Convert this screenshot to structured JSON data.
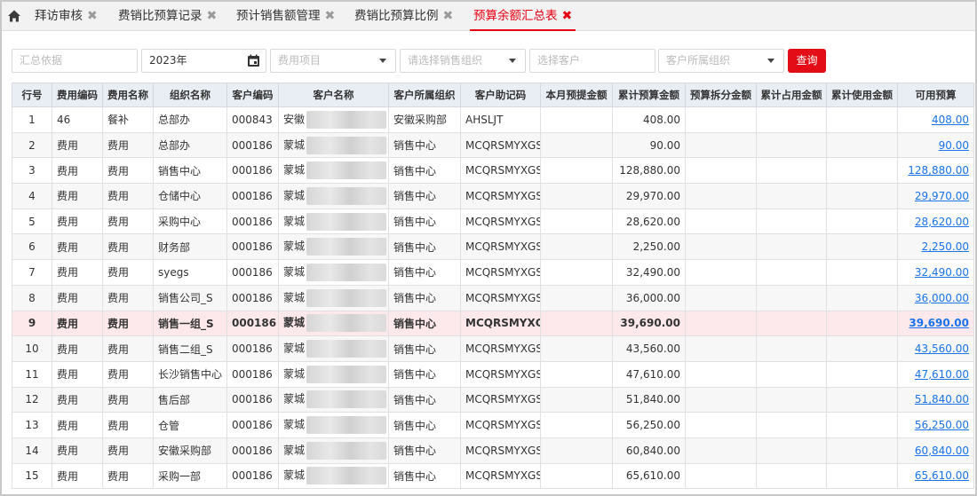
{
  "tabs": [
    {
      "label": "拜访审核",
      "close": "✖"
    },
    {
      "label": "费销比预算记录",
      "close": "✖"
    },
    {
      "label": "预计销售额管理",
      "close": "✖"
    },
    {
      "label": "费销比预算比例",
      "close": "✖"
    },
    {
      "label": "预算余额汇总表",
      "close": "✖"
    }
  ],
  "filters": {
    "summary_basis_placeholder": "汇总依据",
    "year_value": "2023年",
    "expense_item_placeholder": "费用项目",
    "sales_org_placeholder": "请选择销售组织",
    "customer_placeholder": "选择客户",
    "customer_org_placeholder": "客户所属组织",
    "query_label": "查询"
  },
  "columns": [
    "行号",
    "费用编码",
    "费用名称",
    "组织名称",
    "客户编码",
    "客户名称",
    "客户所属组织",
    "客户助记码",
    "本月预提金额",
    "累计预算金额",
    "预算拆分金额",
    "累计占用金额",
    "累计使用金额",
    "可用预算"
  ],
  "rows": [
    {
      "no": "1",
      "code": "46",
      "name": "餐补",
      "org": "总部办",
      "cust_code": "000843",
      "cust_name": "安徽",
      "cust_org": "安徽采购部",
      "mnemonic": "AHSLJT",
      "month": "",
      "budget": "408.00",
      "split": "",
      "occupied": "",
      "used": "",
      "available": "408.00"
    },
    {
      "no": "2",
      "code": "费用",
      "name": "费用",
      "org": "总部办",
      "cust_code": "000186",
      "cust_name": "蒙城",
      "cust_org": "销售中心",
      "mnemonic": "MCQRSMYXGS",
      "month": "",
      "budget": "90.00",
      "split": "",
      "occupied": "",
      "used": "",
      "available": "90.00"
    },
    {
      "no": "3",
      "code": "费用",
      "name": "费用",
      "org": "销售中心",
      "cust_code": "000186",
      "cust_name": "蒙城",
      "cust_org": "销售中心",
      "mnemonic": "MCQRSMYXGS",
      "month": "",
      "budget": "128,880.00",
      "split": "",
      "occupied": "",
      "used": "",
      "available": "128,880.00"
    },
    {
      "no": "4",
      "code": "费用",
      "name": "费用",
      "org": "仓储中心",
      "cust_code": "000186",
      "cust_name": "蒙城",
      "cust_org": "销售中心",
      "mnemonic": "MCQRSMYXGS",
      "month": "",
      "budget": "29,970.00",
      "split": "",
      "occupied": "",
      "used": "",
      "available": "29,970.00"
    },
    {
      "no": "5",
      "code": "费用",
      "name": "费用",
      "org": "采购中心",
      "cust_code": "000186",
      "cust_name": "蒙城",
      "cust_org": "销售中心",
      "mnemonic": "MCQRSMYXGS",
      "month": "",
      "budget": "28,620.00",
      "split": "",
      "occupied": "",
      "used": "",
      "available": "28,620.00"
    },
    {
      "no": "6",
      "code": "费用",
      "name": "费用",
      "org": "财务部",
      "cust_code": "000186",
      "cust_name": "蒙城",
      "cust_org": "销售中心",
      "mnemonic": "MCQRSMYXGS",
      "month": "",
      "budget": "2,250.00",
      "split": "",
      "occupied": "",
      "used": "",
      "available": "2,250.00"
    },
    {
      "no": "7",
      "code": "费用",
      "name": "费用",
      "org": "syegs",
      "cust_code": "000186",
      "cust_name": "蒙城",
      "cust_org": "销售中心",
      "mnemonic": "MCQRSMYXGS",
      "month": "",
      "budget": "32,490.00",
      "split": "",
      "occupied": "",
      "used": "",
      "available": "32,490.00"
    },
    {
      "no": "8",
      "code": "费用",
      "name": "费用",
      "org": "销售公司_S",
      "cust_code": "000186",
      "cust_name": "蒙城",
      "cust_org": "销售中心",
      "mnemonic": "MCQRSMYXGS",
      "month": "",
      "budget": "36,000.00",
      "split": "",
      "occupied": "",
      "used": "",
      "available": "36,000.00"
    },
    {
      "no": "9",
      "code": "费用",
      "name": "费用",
      "org": "销售一组_S",
      "cust_code": "000186",
      "cust_name": "蒙城",
      "cust_org": "销售中心",
      "mnemonic": "MCQRSMYXGS",
      "month": "",
      "budget": "39,690.00",
      "split": "",
      "occupied": "",
      "used": "",
      "available": "39,690.00"
    },
    {
      "no": "10",
      "code": "费用",
      "name": "费用",
      "org": "销售二组_S",
      "cust_code": "000186",
      "cust_name": "蒙城",
      "cust_org": "销售中心",
      "mnemonic": "MCQRSMYXGS",
      "month": "",
      "budget": "43,560.00",
      "split": "",
      "occupied": "",
      "used": "",
      "available": "43,560.00"
    },
    {
      "no": "11",
      "code": "费用",
      "name": "费用",
      "org": "长沙销售中心",
      "cust_code": "000186",
      "cust_name": "蒙城",
      "cust_org": "销售中心",
      "mnemonic": "MCQRSMYXGS",
      "month": "",
      "budget": "47,610.00",
      "split": "",
      "occupied": "",
      "used": "",
      "available": "47,610.00"
    },
    {
      "no": "12",
      "code": "费用",
      "name": "费用",
      "org": "售后部",
      "cust_code": "000186",
      "cust_name": "蒙城",
      "cust_org": "销售中心",
      "mnemonic": "MCQRSMYXGS",
      "month": "",
      "budget": "51,840.00",
      "split": "",
      "occupied": "",
      "used": "",
      "available": "51,840.00"
    },
    {
      "no": "13",
      "code": "费用",
      "name": "费用",
      "org": "仓管",
      "cust_code": "000186",
      "cust_name": "蒙城",
      "cust_org": "销售中心",
      "mnemonic": "MCQRSMYXGS",
      "month": "",
      "budget": "56,250.00",
      "split": "",
      "occupied": "",
      "used": "",
      "available": "56,250.00"
    },
    {
      "no": "14",
      "code": "费用",
      "name": "费用",
      "org": "安徽采购部",
      "cust_code": "000186",
      "cust_name": "蒙城",
      "cust_org": "销售中心",
      "mnemonic": "MCQRSMYXGS",
      "month": "",
      "budget": "60,840.00",
      "split": "",
      "occupied": "",
      "used": "",
      "available": "60,840.00"
    },
    {
      "no": "15",
      "code": "费用",
      "name": "费用",
      "org": "采购一部",
      "cust_code": "000186",
      "cust_name": "蒙城",
      "cust_org": "销售中心",
      "mnemonic": "MCQRSMYXGS",
      "month": "",
      "budget": "65,610.00",
      "split": "",
      "occupied": "",
      "used": "",
      "available": "65,610.00"
    }
  ],
  "highlighted_row": 9,
  "colors": {
    "accent": "#e30d17",
    "link": "#1a73e8",
    "header_bg": "#e9eef5",
    "highlight_row": "#fde9ec"
  }
}
